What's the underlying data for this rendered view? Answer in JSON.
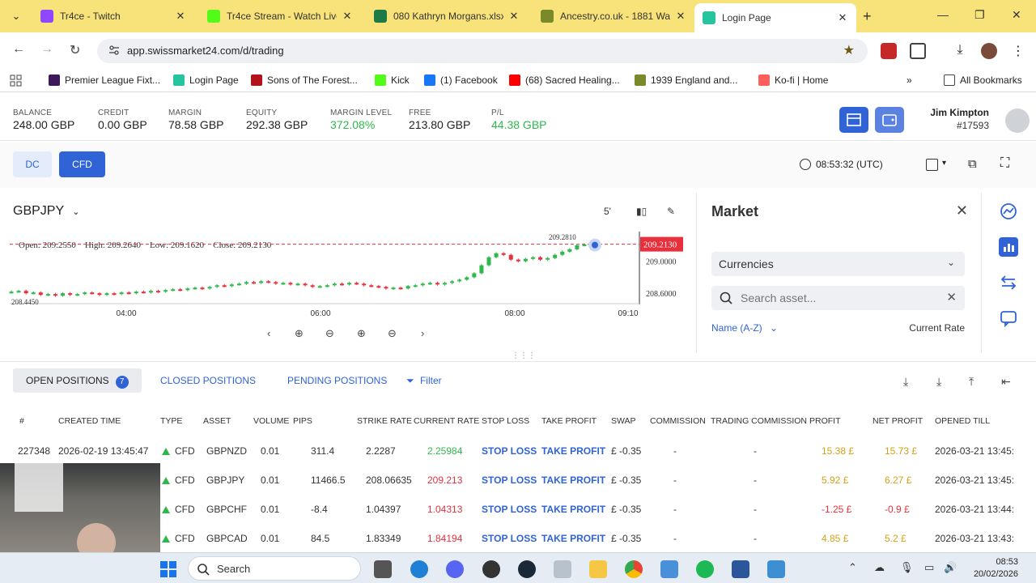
{
  "browser": {
    "tabs": [
      {
        "title": "Tr4ce - Twitch",
        "color": "#9146ff"
      },
      {
        "title": "Tr4ce Stream - Watch Live",
        "color": "#53fc18"
      },
      {
        "title": "080 Kathryn Morgans.xlsx",
        "color": "#1e7b45"
      },
      {
        "title": "Ancestry.co.uk - 1881 Wa",
        "color": "#7a8a2a"
      },
      {
        "title": "Login Page",
        "color": "#27c4a0"
      }
    ],
    "url": "app.swissmarket24.com/d/trading",
    "bookmarks": [
      {
        "label": "Premier League Fixt...",
        "color": "#3d195b"
      },
      {
        "label": "Login Page",
        "color": "#27c4a0"
      },
      {
        "label": "Sons of The Forest...",
        "color": "#b3121a"
      },
      {
        "label": "Kick",
        "color": "#53fc18"
      },
      {
        "label": "(1) Facebook",
        "color": "#1877f2"
      },
      {
        "label": "(68) Sacred Healing...",
        "color": "#ff0000"
      },
      {
        "label": "1939 England and...",
        "color": "#7a8a2a"
      },
      {
        "label": "Ko-fi | Home",
        "color": "#ff5e5b"
      }
    ],
    "all_bookmarks": "All Bookmarks"
  },
  "account": {
    "stats": [
      {
        "label": "BALANCE",
        "value": "248.00 GBP",
        "green": false
      },
      {
        "label": "CREDIT",
        "value": "0.00 GBP",
        "green": false
      },
      {
        "label": "MARGIN",
        "value": "78.58 GBP",
        "green": false
      },
      {
        "label": "EQUITY",
        "value": "292.38 GBP",
        "green": false
      },
      {
        "label": "MARGIN LEVEL",
        "value": "372.08%",
        "green": true
      },
      {
        "label": "FREE",
        "value": "213.80 GBP",
        "green": false
      },
      {
        "label": "P/L",
        "value": "44.38 GBP",
        "green": true
      }
    ],
    "user_name": "Jim Kimpton",
    "user_id": "#17593"
  },
  "modes": {
    "dc": "DC",
    "cfd": "CFD"
  },
  "clock": "08:53:32 (UTC)",
  "chart": {
    "symbol": "GBPJPY",
    "timeframe": "5'",
    "ohlc": "Open: 209.2550    High: 209.2640    Low: 209.1620    Close: 209.2130",
    "high_marker": "209.2810",
    "low_marker": "208.4450",
    "current_price": "209.2130",
    "y_ticks": [
      "209.0000",
      "208.6000"
    ],
    "x_ticks": [
      "04:00",
      "06:00",
      "08:00",
      "09:10"
    ]
  },
  "chart_data": {
    "type": "candlestick",
    "title": "GBPJPY",
    "xlabel": "",
    "ylabel": "",
    "x_ticks": [
      "04:00",
      "06:00",
      "08:00",
      "09:10"
    ],
    "y_ticks": [
      209.0,
      208.6
    ],
    "ylim": [
      208.44,
      209.29
    ],
    "current": 209.213,
    "closes": [
      208.62,
      208.63,
      208.6,
      208.61,
      208.58,
      208.59,
      208.57,
      208.6,
      208.58,
      208.59,
      208.61,
      208.6,
      208.58,
      208.6,
      208.59,
      208.61,
      208.6,
      208.62,
      208.61,
      208.63,
      208.62,
      208.64,
      208.65,
      208.64,
      208.66,
      208.67,
      208.66,
      208.68,
      208.7,
      208.69,
      208.71,
      208.72,
      208.74,
      208.73,
      208.75,
      208.74,
      208.72,
      208.73,
      208.71,
      208.72,
      208.7,
      208.68,
      208.69,
      208.7,
      208.72,
      208.71,
      208.73,
      208.72,
      208.7,
      208.69,
      208.68,
      208.66,
      208.67,
      208.66,
      208.69,
      208.7,
      208.72,
      208.73,
      208.71,
      208.73,
      208.75,
      208.77,
      208.8,
      208.85,
      208.95,
      209.05,
      209.1,
      209.08,
      209.02,
      209.0,
      209.03,
      209.05,
      209.02,
      209.04,
      209.08,
      209.12,
      209.15,
      209.2,
      209.21
    ]
  },
  "market": {
    "title": "Market",
    "category": "Currencies",
    "search_placeholder": "Search asset...",
    "sort_label": "Name (A-Z)",
    "rate_label": "Current Rate"
  },
  "positions": {
    "tabs": {
      "open": "OPEN POSITIONS",
      "open_count": "7",
      "closed": "CLOSED POSITIONS",
      "pending": "PENDING POSITIONS",
      "filter": "Filter"
    },
    "columns": [
      "#",
      "CREATED TIME",
      "TYPE",
      "ASSET",
      "VOLUME",
      "PIPS",
      "STRIKE RATE",
      "CURRENT RATE",
      "STOP LOSS",
      "TAKE PROFIT",
      "SWAP",
      "COMMISSION",
      "TRADING COMMISSION",
      "PROFIT",
      "NET PROFIT",
      "OPENED TILL"
    ],
    "rows": [
      {
        "id": "227348",
        "created": "2026-02-19 13:45:47",
        "type": "CFD",
        "asset": "GBPNZD",
        "volume": "0.01",
        "pips": "311.4",
        "strike": "2.2287",
        "current": "2.25984",
        "current_color": "green",
        "sl": "STOP LOSS",
        "tp": "TAKE PROFIT",
        "swap": "£ -0.35",
        "commission": "-",
        "trading_commission": "-",
        "profit": "15.38 £",
        "net_profit": "15.73 £",
        "profit_color": "gold",
        "opened_till": "2026-03-21 13:45:"
      },
      {
        "id": "",
        "created": "",
        "type": "CFD",
        "asset": "GBPJPY",
        "volume": "0.01",
        "pips": "11466.5",
        "strike": "208.06635",
        "current": "209.213",
        "current_color": "red",
        "sl": "STOP LOSS",
        "tp": "TAKE PROFIT",
        "swap": "£ -0.35",
        "commission": "-",
        "trading_commission": "-",
        "profit": "5.92 £",
        "net_profit": "6.27 £",
        "profit_color": "gold",
        "opened_till": "2026-03-21 13:45:"
      },
      {
        "id": "",
        "created": "",
        "type": "CFD",
        "asset": "GBPCHF",
        "volume": "0.01",
        "pips": "-8.4",
        "strike": "1.04397",
        "current": "1.04313",
        "current_color": "red",
        "sl": "STOP LOSS",
        "tp": "TAKE PROFIT",
        "swap": "£ -0.35",
        "commission": "-",
        "trading_commission": "-",
        "profit": "-1.25 £",
        "net_profit": "-0.9 £",
        "profit_color": "red",
        "opened_till": "2026-03-21 13:44:"
      },
      {
        "id": "",
        "created": "",
        "type": "CFD",
        "asset": "GBPCAD",
        "volume": "0.01",
        "pips": "84.5",
        "strike": "1.83349",
        "current": "1.84194",
        "current_color": "red",
        "sl": "STOP LOSS",
        "tp": "TAKE PROFIT",
        "swap": "£ -0.35",
        "commission": "-",
        "trading_commission": "-",
        "profit": "4.85 £",
        "net_profit": "5.2 £",
        "profit_color": "gold",
        "opened_till": "2026-03-21 13:43:"
      }
    ]
  },
  "taskbar": {
    "search_label": "Search",
    "time": "08:53",
    "date": "20/02/2026"
  }
}
